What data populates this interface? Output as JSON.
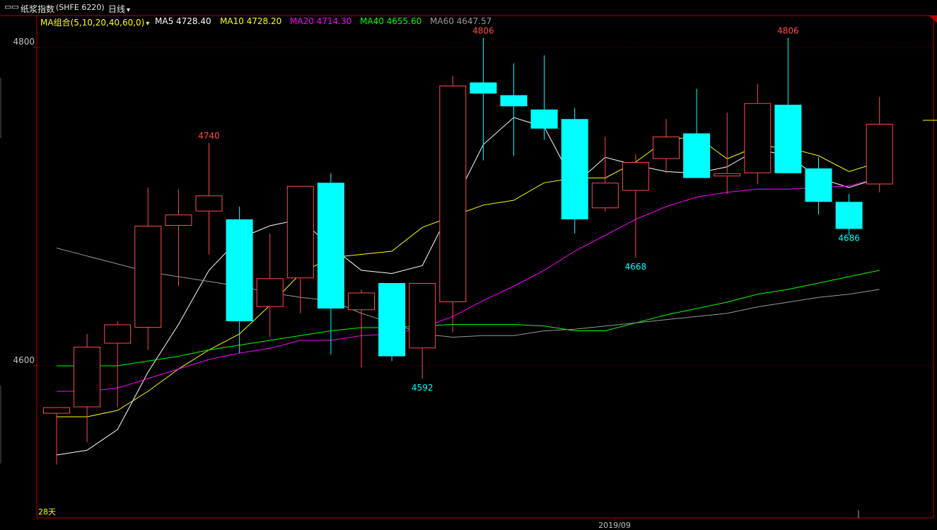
{
  "header": {
    "instrument_title": "纸浆指数",
    "instrument_code": "(SHFE 6220)",
    "period_label": "日线",
    "ma_group_label": "MA组合(5,10,20,40,60,0)",
    "ma5_label": "MA5 4728.40",
    "ma10_label": "MA10 4728.20",
    "ma20_label": "MA20 4714.30",
    "ma40_label": "MA40 4655.60",
    "ma60_label": "MA60 4647.57"
  },
  "colors": {
    "up": "#ff4a4a",
    "down": "#00ffff",
    "ma5": "#ffffff",
    "ma10": "#ffff00",
    "ma20": "#ff00ff",
    "ma40": "#00ff00",
    "ma60": "#999999",
    "axis": "#b00000"
  },
  "footer": {
    "date_label": "2019/09",
    "corner_label": "28天"
  },
  "chart_data": {
    "type": "candlestick",
    "y_ticks": [
      4600,
      4800
    ],
    "ylim": [
      4525,
      4830
    ],
    "candles": [
      {
        "open": 4570,
        "close": 4574,
        "high": 4574,
        "low": 4538
      },
      {
        "open": 4574,
        "close": 4612,
        "high": 4620,
        "low": 4552
      },
      {
        "open": 4614,
        "close": 4626,
        "high": 4628,
        "low": 4574
      },
      {
        "open": 4624,
        "close": 4688,
        "high": 4712,
        "low": 4610
      },
      {
        "open": 4688,
        "close": 4695,
        "high": 4711,
        "low": 4650
      },
      {
        "open": 4697,
        "close": 4707,
        "high": 4740,
        "low": 4670
      },
      {
        "open": 4692,
        "close": 4628,
        "high": 4700,
        "low": 4608
      },
      {
        "open": 4637,
        "close": 4655,
        "high": 4683,
        "low": 4618
      },
      {
        "open": 4655,
        "close": 4713,
        "high": 4713,
        "low": 4633
      },
      {
        "open": 4715,
        "close": 4636,
        "high": 4721,
        "low": 4607
      },
      {
        "open": 4635,
        "close": 4646,
        "high": 4648,
        "low": 4599
      },
      {
        "open": 4652,
        "close": 4606,
        "high": 4652,
        "low": 4603
      },
      {
        "open": 4611,
        "close": 4652,
        "high": 4652,
        "low": 4592
      },
      {
        "open": 4640,
        "close": 4776,
        "high": 4782,
        "low": 4621
      },
      {
        "open": 4778,
        "close": 4771,
        "high": 4806,
        "low": 4729
      },
      {
        "open": 4770,
        "close": 4763,
        "high": 4790,
        "low": 4732
      },
      {
        "open": 4761,
        "close": 4749,
        "high": 4795,
        "low": 4742
      },
      {
        "open": 4755,
        "close": 4692,
        "high": 4762,
        "low": 4683
      },
      {
        "open": 4699,
        "close": 4715,
        "high": 4744,
        "low": 4697
      },
      {
        "open": 4710,
        "close": 4728,
        "high": 4733,
        "low": 4668
      },
      {
        "open": 4730,
        "close": 4744,
        "high": 4755,
        "low": 4721
      },
      {
        "open": 4746,
        "close": 4718,
        "high": 4774,
        "low": 4718
      },
      {
        "open": 4719,
        "close": 4721,
        "high": 4759,
        "low": 4708
      },
      {
        "open": 4721,
        "close": 4765,
        "high": 4777,
        "low": 4714
      },
      {
        "open": 4764,
        "close": 4721,
        "high": 4806,
        "low": 4721
      },
      {
        "open": 4724,
        "close": 4703,
        "high": 4731,
        "low": 4695
      },
      {
        "open": 4703,
        "close": 4686,
        "high": 4708,
        "low": 4682
      },
      {
        "open": 4714,
        "close": 4752,
        "high": 4769,
        "low": 4709
      }
    ],
    "ma_series": [
      {
        "name": "MA5",
        "values": [
          4544,
          4547,
          4560,
          4596,
          4626,
          4660,
          4680,
          4688,
          4692,
          4675,
          4660,
          4658,
          4663,
          4701,
          4739,
          4756,
          4750,
          4714,
          4731,
          4726,
          4722,
          4721,
          4725,
          4736,
          4732,
          4718,
          4712,
          4718
        ]
      },
      {
        "name": "MA10",
        "values": [
          4568,
          4568,
          4572,
          4584,
          4598,
          4610,
          4620,
          4638,
          4658,
          4668,
          4670,
          4672,
          4687,
          4694,
          4701,
          4704,
          4715,
          4718,
          4718,
          4728,
          4742,
          4744,
          4730,
          4738,
          4737,
          4732,
          4722,
          4728
        ]
      },
      {
        "name": "MA20",
        "values": [
          4584,
          4584,
          4586,
          4592,
          4598,
          4604,
          4608,
          4611,
          4616,
          4616,
          4619,
          4620,
          4624,
          4631,
          4641,
          4650,
          4660,
          4672,
          4682,
          4692,
          4700,
          4706,
          4709,
          4711,
          4711,
          4712,
          4713,
          4718
        ]
      },
      {
        "name": "MA40",
        "values": [
          4600,
          4600,
          4600,
          4603,
          4606,
          4610,
          4613,
          4616,
          4619,
          4622,
          4624,
          4624,
          4625,
          4626,
          4626,
          4626,
          4625,
          4622,
          4622,
          4627,
          4632,
          4636,
          4640,
          4645,
          4648,
          4652,
          4656,
          4660
        ]
      },
      {
        "name": "MA60",
        "values": [
          4674,
          4669,
          4664,
          4659,
          4656,
          4653,
          4650,
          4646,
          4643,
          4641,
          4633,
          4627,
          4620,
          4618,
          4619,
          4619,
          4622,
          4623,
          4625,
          4627,
          4629,
          4631,
          4633,
          4637,
          4640,
          4643,
          4645,
          4648
        ]
      }
    ],
    "annotations": [
      {
        "text": "4806",
        "index": 14,
        "value": 4806,
        "position": "above",
        "color": "up"
      },
      {
        "text": "4806",
        "index": 24,
        "value": 4806,
        "position": "above",
        "color": "up"
      },
      {
        "text": "4740",
        "index": 5,
        "value": 4740,
        "position": "above",
        "color": "up"
      },
      {
        "text": "4668",
        "index": 19,
        "value": 4668,
        "position": "below",
        "color": "down"
      },
      {
        "text": "4592",
        "index": 12,
        "value": 4592,
        "position": "below",
        "color": "down"
      },
      {
        "text": "4686",
        "index": 26,
        "value": 4686,
        "position": "below",
        "color": "down"
      }
    ]
  }
}
